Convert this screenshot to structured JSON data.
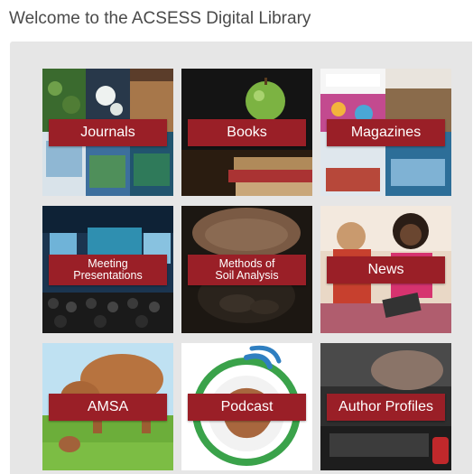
{
  "page": {
    "title": "Welcome to the ACSESS Digital Library"
  },
  "tiles": [
    {
      "label": "Journals"
    },
    {
      "label": "Books"
    },
    {
      "label": "Magazines"
    },
    {
      "label": "Meeting\nPresentations"
    },
    {
      "label": "Methods of\nSoil Analysis"
    },
    {
      "label": "News"
    },
    {
      "label": "AMSA"
    },
    {
      "label": "Podcast"
    },
    {
      "label": "Author Profiles"
    }
  ],
  "colors": {
    "label_background": "#9a1f27",
    "label_text": "#ffffff",
    "panel_background": "#e6e6e6",
    "title_text": "#4a4a4a"
  }
}
